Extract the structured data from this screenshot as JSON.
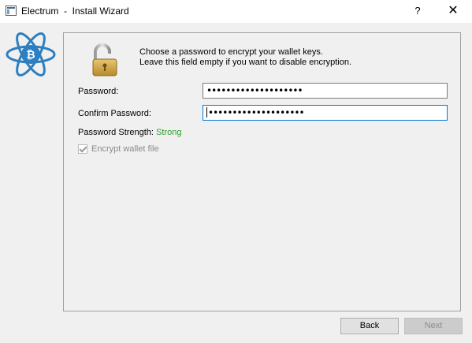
{
  "window": {
    "title": "Electrum  -  Install Wizard",
    "help_glyph": "?",
    "close_glyph": "✕"
  },
  "message": {
    "line1": "Choose a password to encrypt your wallet keys.",
    "line2": "Leave this field empty if you want to disable encryption."
  },
  "form": {
    "password_label": "Password:",
    "password_value": "••••••••••••••••••••",
    "confirm_label": "Confirm Password:",
    "confirm_value": "••••••••••••••••••••",
    "strength_label": "Password Strength:",
    "strength_value": "Strong",
    "encrypt_label": "Encrypt wallet file",
    "encrypt_checked": true,
    "encrypt_enabled": false
  },
  "buttons": {
    "back": "Back",
    "next": "Next"
  },
  "colors": {
    "strength_good": "#2f9e2f",
    "focus_border": "#0078d7",
    "logo_blue": "#2d7fc1"
  },
  "icons": {
    "app": "electrum-app-icon",
    "logo": "electrum-logo-icon",
    "lock": "padlock-icon"
  }
}
